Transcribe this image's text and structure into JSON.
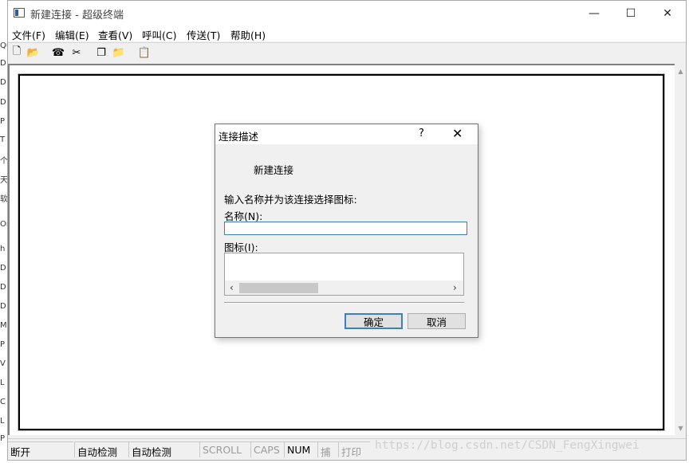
{
  "background_window_fragments": [
    "Qu",
    "D",
    "D",
    "D",
    "P",
    "T",
    "个",
    "天",
    "软",
    "On",
    "h",
    "D",
    "D",
    "D",
    "M",
    "P",
    "V",
    "L",
    "C",
    "L",
    "P"
  ],
  "window": {
    "title": "新建连接 - 超级终端",
    "controls": {
      "minimize": "—",
      "maximize": "☐",
      "close": "✕"
    }
  },
  "menu": [
    {
      "label": "文件(F)"
    },
    {
      "label": "编辑(E)"
    },
    {
      "label": "查看(V)"
    },
    {
      "label": "呼叫(C)"
    },
    {
      "label": "传送(T)"
    },
    {
      "label": "帮助(H)"
    }
  ],
  "toolbar": [
    {
      "icon": "new-file-icon",
      "glyph": "🗋"
    },
    {
      "icon": "open-folder-icon",
      "glyph": "📂"
    },
    {
      "icon": "connect-phone-icon",
      "glyph": "☎"
    },
    {
      "icon": "disconnect-icon",
      "glyph": "✂"
    },
    {
      "icon": "send-file-icon",
      "glyph": "❐"
    },
    {
      "icon": "receive-file-icon",
      "glyph": "📁"
    },
    {
      "icon": "properties-icon",
      "glyph": "📋"
    }
  ],
  "statusbar": {
    "connection": "断开",
    "detect1": "自动检测",
    "detect2": "自动检测",
    "scroll": "SCROLL",
    "caps": "CAPS",
    "num": "NUM",
    "capture": "捕",
    "print": "打印"
  },
  "watermark": "https://blog.csdn.net/CSDN_FengXingwei",
  "dialog": {
    "title": "连接描述",
    "help": "?",
    "close": "✕",
    "description": "新建连接",
    "prompt": "输入名称并为该连接选择图标:",
    "name_label": "名称(N):",
    "name_value": "",
    "icon_label": "图标(I):",
    "scroll_left": "‹",
    "scroll_right": "›",
    "ok_label": "确定",
    "cancel_label": "取消"
  },
  "colors": {
    "accent": "#3c7fc5",
    "window_bg": "#f0f0f0"
  }
}
